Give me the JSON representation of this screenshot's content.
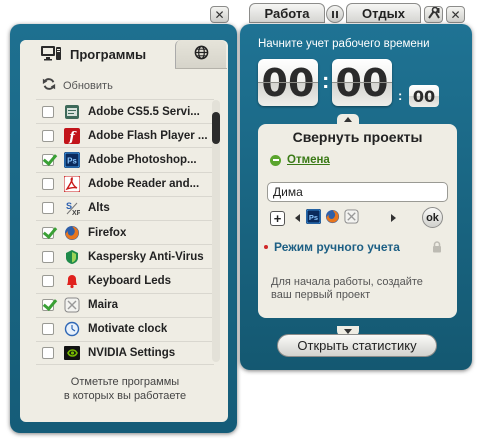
{
  "left_window": {
    "tab_programs_label": "Программы",
    "refresh_label": "Обновить",
    "programs": [
      {
        "name": "Adobe CS5.5 Servi...",
        "checked": false,
        "icon": "adobe-cs-icon"
      },
      {
        "name": "Adobe Flash Player ...",
        "checked": false,
        "icon": "flash-icon"
      },
      {
        "name": "Adobe Photoshop...",
        "checked": true,
        "icon": "photoshop-icon"
      },
      {
        "name": "Adobe Reader and...",
        "checked": false,
        "icon": "acrobat-icon"
      },
      {
        "name": "Alts",
        "checked": false,
        "icon": "alts-icon"
      },
      {
        "name": "Firefox",
        "checked": true,
        "icon": "firefox-icon"
      },
      {
        "name": "Kaspersky Anti-Virus",
        "checked": false,
        "icon": "kaspersky-icon"
      },
      {
        "name": "Keyboard Leds",
        "checked": false,
        "icon": "bell-icon"
      },
      {
        "name": "Maira",
        "checked": true,
        "icon": "maira-icon"
      },
      {
        "name": "Motivate clock",
        "checked": false,
        "icon": "clock-icon"
      },
      {
        "name": "NVIDIA Settings",
        "checked": false,
        "icon": "nvidia-icon"
      }
    ],
    "footer_line1": "Отметьте программы",
    "footer_line2": "в которых вы работаете",
    "close_glyph": "✕"
  },
  "right_window": {
    "tab_work": "Работа",
    "tab_rest": "Отдых",
    "close_glyph": "✕",
    "timer_label": "Начните учет рабочего времени",
    "hours": "00",
    "minutes": "00",
    "seconds": "00",
    "colon": ":",
    "projects_title": "Свернуть проекты",
    "cancel_label": "Отмена",
    "name_value": "Дима",
    "ok_label": "ok",
    "mode_label": "Режим ручного учета",
    "hint_line1": "Для начала работы, создайте",
    "hint_line2": "ваш первый проект",
    "stats_button": "Открыть статистику"
  },
  "colors": {
    "window_blue": "#1a6888",
    "panel_beige": "#efede4",
    "check_green": "#3aa035",
    "mode_link": "#1d5f84"
  }
}
